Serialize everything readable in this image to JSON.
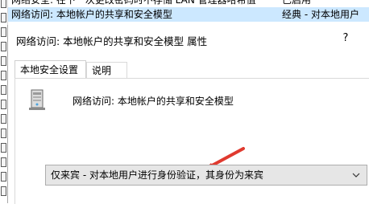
{
  "background_list": {
    "rows": [
      {
        "name": "网络安全: 在下一次更改密码时不存储 LAN 管理器哈希值",
        "value": "已启用"
      },
      {
        "name": "网络访问: 本地帐户的共享和安全模型",
        "value": "经典 - 对本地用户"
      }
    ]
  },
  "dialog": {
    "title": "网络访问: 本地帐户的共享和安全模型 属性",
    "help_label": "?",
    "tabs": [
      {
        "label": "本地安全设置"
      },
      {
        "label": "说明"
      }
    ],
    "policy_name": "网络访问: 本地帐户的共享和安全模型",
    "policy_icon": "server-policy-icon",
    "dropdown": {
      "selected": "仅来宾 - 对本地用户进行身份验证，其身份为来宾"
    },
    "annotation": {
      "arrow_color": "#e03a2f"
    }
  }
}
